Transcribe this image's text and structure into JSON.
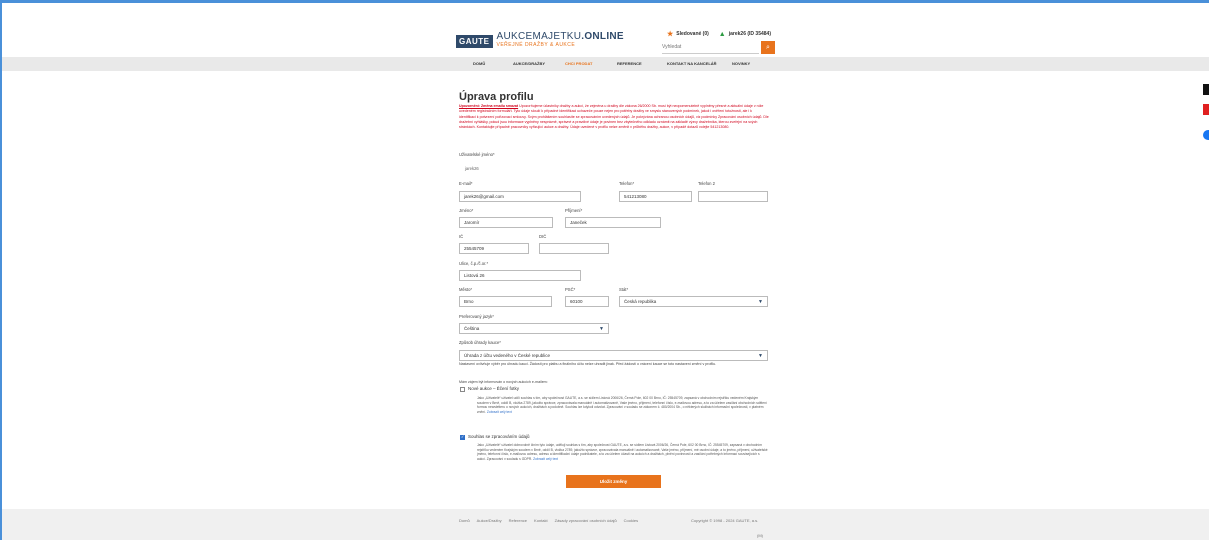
{
  "brand": {
    "box": "GAUTE",
    "name_light": "AUKCEMAJETKU",
    "name_bold": ".ONLINE",
    "tagline": "VEŘEJNÉ DRAŽBY & AUKCE",
    "colors": {
      "accent": "#e8731c",
      "brand": "#2f4a6a",
      "warning": "#d0021b"
    }
  },
  "header": {
    "watched": "Sledované (0)",
    "user": "jarek26 (ID 35484)",
    "search_placeholder": "Vyhledat"
  },
  "nav": [
    "DOMŮ",
    "AUKCE/DRAŽBY",
    "CHCI PRODAT",
    "REFERENCE",
    "KONTAKT NA KANCELÁŘ",
    "NOVINKY"
  ],
  "page": {
    "title": "Úprava profilu",
    "warning_bold": "Upozornění: Změna emailu smazat",
    "warning_text": " Upozorňujeme účastníky dražby a aukcí, že zejména u dražby dle zákona 26/2000 Sb. musí být neopomenutelně vyplněny přesné a aktuální údaje v níže uvedeném registračním formuláři. Tyto údaje slouží k případné identifikaci uchazeče pouze nejen pro potřeby dražby ve smyslu stanovených podmínek, jakož i ověření totožnosti, ale i k identifikaci k potvrzení pořizovací smlouvy. Svým prohlášením souhlasíte se zpracováním uvedených údajů. Je pokrývána ochranou osobních údajů, viz podmínky Zpracování osobních údajů. Dle dražební vyhlášky, pokud jsou informace vyplněny nesprávně, správné a pravdivé údaje je povinen bez zbytečného odkladu oznámit na základě výzvy dražebníka, kterou zveřejní na svých stránkách. Kontaktujte případně pracovníky vyřizující aukce a dražby. Údaje uvedené v profilu nelze změnit v průběhu dražby, aukce, v případě dotazů volejte 541213080."
  },
  "form": {
    "username_label": "Uživatelské jméno*",
    "username_value": "jarek26",
    "email_label": "E-mail*",
    "email_value": "jarek26@gmail.com",
    "phone_label": "Telefon*",
    "phone_value": "541213080",
    "phone2_label": "Telefon 2",
    "phone2_value": "",
    "firstname_label": "Jméno*",
    "firstname_value": "Jaromír",
    "lastname_label": "Příjmení*",
    "lastname_value": "Janeček",
    "ic_label": "IČ",
    "ic_value": "25545709",
    "dic_label": "DIČ",
    "dic_value": "",
    "street_label": "Ulice, č.p./č.or.*",
    "street_value": "Listová 26",
    "city_label": "Město*",
    "city_value": "Brno",
    "zip_label": "PSČ*",
    "zip_value": "60100",
    "country_label": "Stát*",
    "country_value": "Česká republika",
    "lang_label": "Preferovaný jazyk*",
    "lang_value": "Čeština",
    "payment_label": "Způsob úhrady kauce*",
    "payment_value": "Úhrada z účtu vedeného v České republice",
    "payment_note": "Nastavení ovlivňuje výběr pro úhradu kauci. Žádosti pro platbu a finálního účtu nelze uhradit jinak. Před žádostí o vrácení kauce se toto nastavení změní v profilu.",
    "newsletter_intro": "Mám zájem být informován o nových aukcích e-mailem:",
    "newsletter_label": "Nové aukce – Ěčení fotky",
    "newsletter_checked": false,
    "newsletter_text": "Jako „Uživatelé“ uživatel udílí souhlas s tím, aby společnost GAUTE, a.s. se sídlem Listová 2006/26, Černá Pole, 602 00 Brno, IČ: 25545709, zapsaná v obchodním rejstříku vedeném Krajským soudem v Brně, oddíl B, vložka 2789, jakožto správce, zpracovávala manuálně i automatizovaně, Vaše jméno, příjmení, telefonní číslo, e-mailovou adresu, a to za účelem zasílání obchodních sdělení formou newsletteru o nových aukcích, dražbách a podobně. Souhlas lze kdykoli odvolat. Zpracování v souladu se zákonem č. 480/2004 Sb., o některých službách informační společnosti, v platném znění.",
    "newsletter_more": "Zobrazit celý text",
    "gdpr_label": "Souhlas se zpracováním údajů",
    "gdpr_checked": true,
    "gdpr_text": "Jako „Uživatelé“ uživatel dobrovolně činím tyto údaje, uděluji souhlas s tím, aby společnost GAUTE, a.s. se sídlem Listová 2006/26, Černá Pole, 602 00 Brno, IČ: 25545709, zapsaná v obchodním rejstříku vedeném Krajským soudem v Brně, oddíl B, vložka 2789, jakožto správce, zpracovávala manuálně i automatizovaně, Vaše jméno, příjmení, mé osobní údaje, a to jméno, příjmení, uživatelské jméno, telefonní číslo, e-mailovou adresu, adresu a identifikační údaje podnikatele, a to za účelem účasti na aukcích a dražbách, plnění povinností a zasílání potřebných informací souvisejících s aukcí. Zpracování v souladu s GDPR.",
    "gdpr_more": "Zobrazit celý text",
    "save_label": "Uložit změny"
  },
  "footer": {
    "links": [
      "Domů",
      "Aukce/Dražby",
      "Reference",
      "Kontakt",
      "Zásady zpracování osobních údajů",
      "Cookies"
    ],
    "copyright": "Copyright © 1998 - 2024 GAUTE, a.s.",
    "version": "(M)"
  }
}
